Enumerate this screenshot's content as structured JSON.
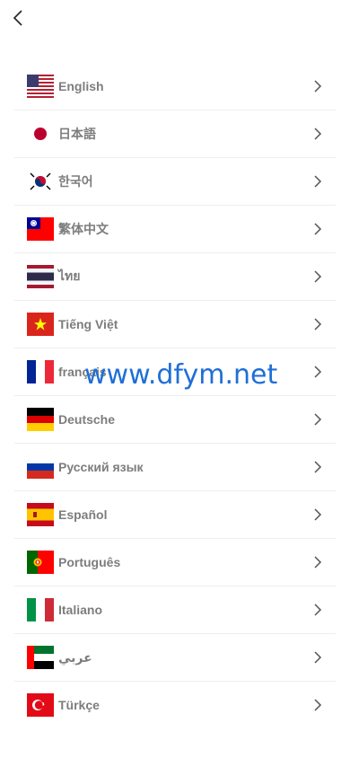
{
  "icons": {
    "back": "chevron-left-icon",
    "row_arrow": "chevron-right-icon"
  },
  "colors": {
    "label": "#7d7d7d",
    "divider": "#eeeeee",
    "watermark": "#1f6fd6"
  },
  "languages": [
    {
      "label": "English",
      "flag": "us-flag-icon"
    },
    {
      "label": "日本語",
      "flag": "japan-flag-icon"
    },
    {
      "label": "한국어",
      "flag": "korea-flag-icon"
    },
    {
      "label": "繁体中文",
      "flag": "taiwan-flag-icon"
    },
    {
      "label": "ไทย",
      "flag": "thailand-flag-icon"
    },
    {
      "label": "Tiếng Việt",
      "flag": "vietnam-flag-icon"
    },
    {
      "label": "français",
      "flag": "france-flag-icon"
    },
    {
      "label": "Deutsche",
      "flag": "germany-flag-icon"
    },
    {
      "label": "Русский язык",
      "flag": "russia-flag-icon"
    },
    {
      "label": "Español",
      "flag": "spain-flag-icon"
    },
    {
      "label": "Português",
      "flag": "portugal-flag-icon"
    },
    {
      "label": "Italiano",
      "flag": "italy-flag-icon"
    },
    {
      "label": "عربي",
      "flag": "uae-flag-icon"
    },
    {
      "label": "Türkçe",
      "flag": "turkey-flag-icon"
    }
  ],
  "watermark": "www.dfym.net"
}
